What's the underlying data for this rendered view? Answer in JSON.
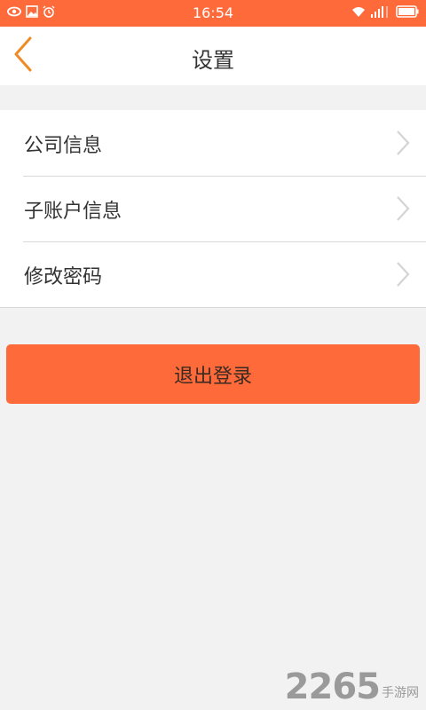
{
  "status_bar": {
    "time": "16:54",
    "left_icons": [
      "eye-icon",
      "image-icon",
      "alarm-icon"
    ],
    "right_icons": [
      "wifi-icon",
      "signal-icon",
      "battery-icon"
    ]
  },
  "header": {
    "title": "设置",
    "back_icon": "chevron-left-icon"
  },
  "settings_list": {
    "items": [
      {
        "label": "公司信息"
      },
      {
        "label": "子账户信息"
      },
      {
        "label": "修改密码"
      }
    ]
  },
  "logout": {
    "label": "退出登录"
  },
  "watermark": {
    "number": "2265",
    "suffix": "手游网"
  },
  "colors": {
    "accent": "#ff6a3b",
    "background": "#f2f2f2",
    "back_arrow": "#f08a24"
  }
}
